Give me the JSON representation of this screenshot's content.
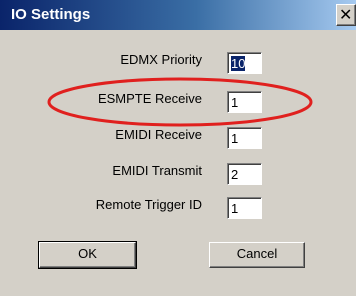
{
  "window": {
    "title": "IO Settings",
    "close_icon": "close-icon"
  },
  "fields": [
    {
      "label": "EDMX Priority",
      "value": "10"
    },
    {
      "label": "ESMPTE Receive",
      "value": "1"
    },
    {
      "label": "EMIDI Receive",
      "value": "1"
    },
    {
      "label": "EMIDI Transmit",
      "value": "2"
    },
    {
      "label": "Remote Trigger ID",
      "value": "1"
    }
  ],
  "buttons": {
    "ok_label": "OK",
    "cancel_label": "Cancel"
  },
  "annotation": {
    "color": "#e0201e",
    "shape": "ellipse"
  }
}
